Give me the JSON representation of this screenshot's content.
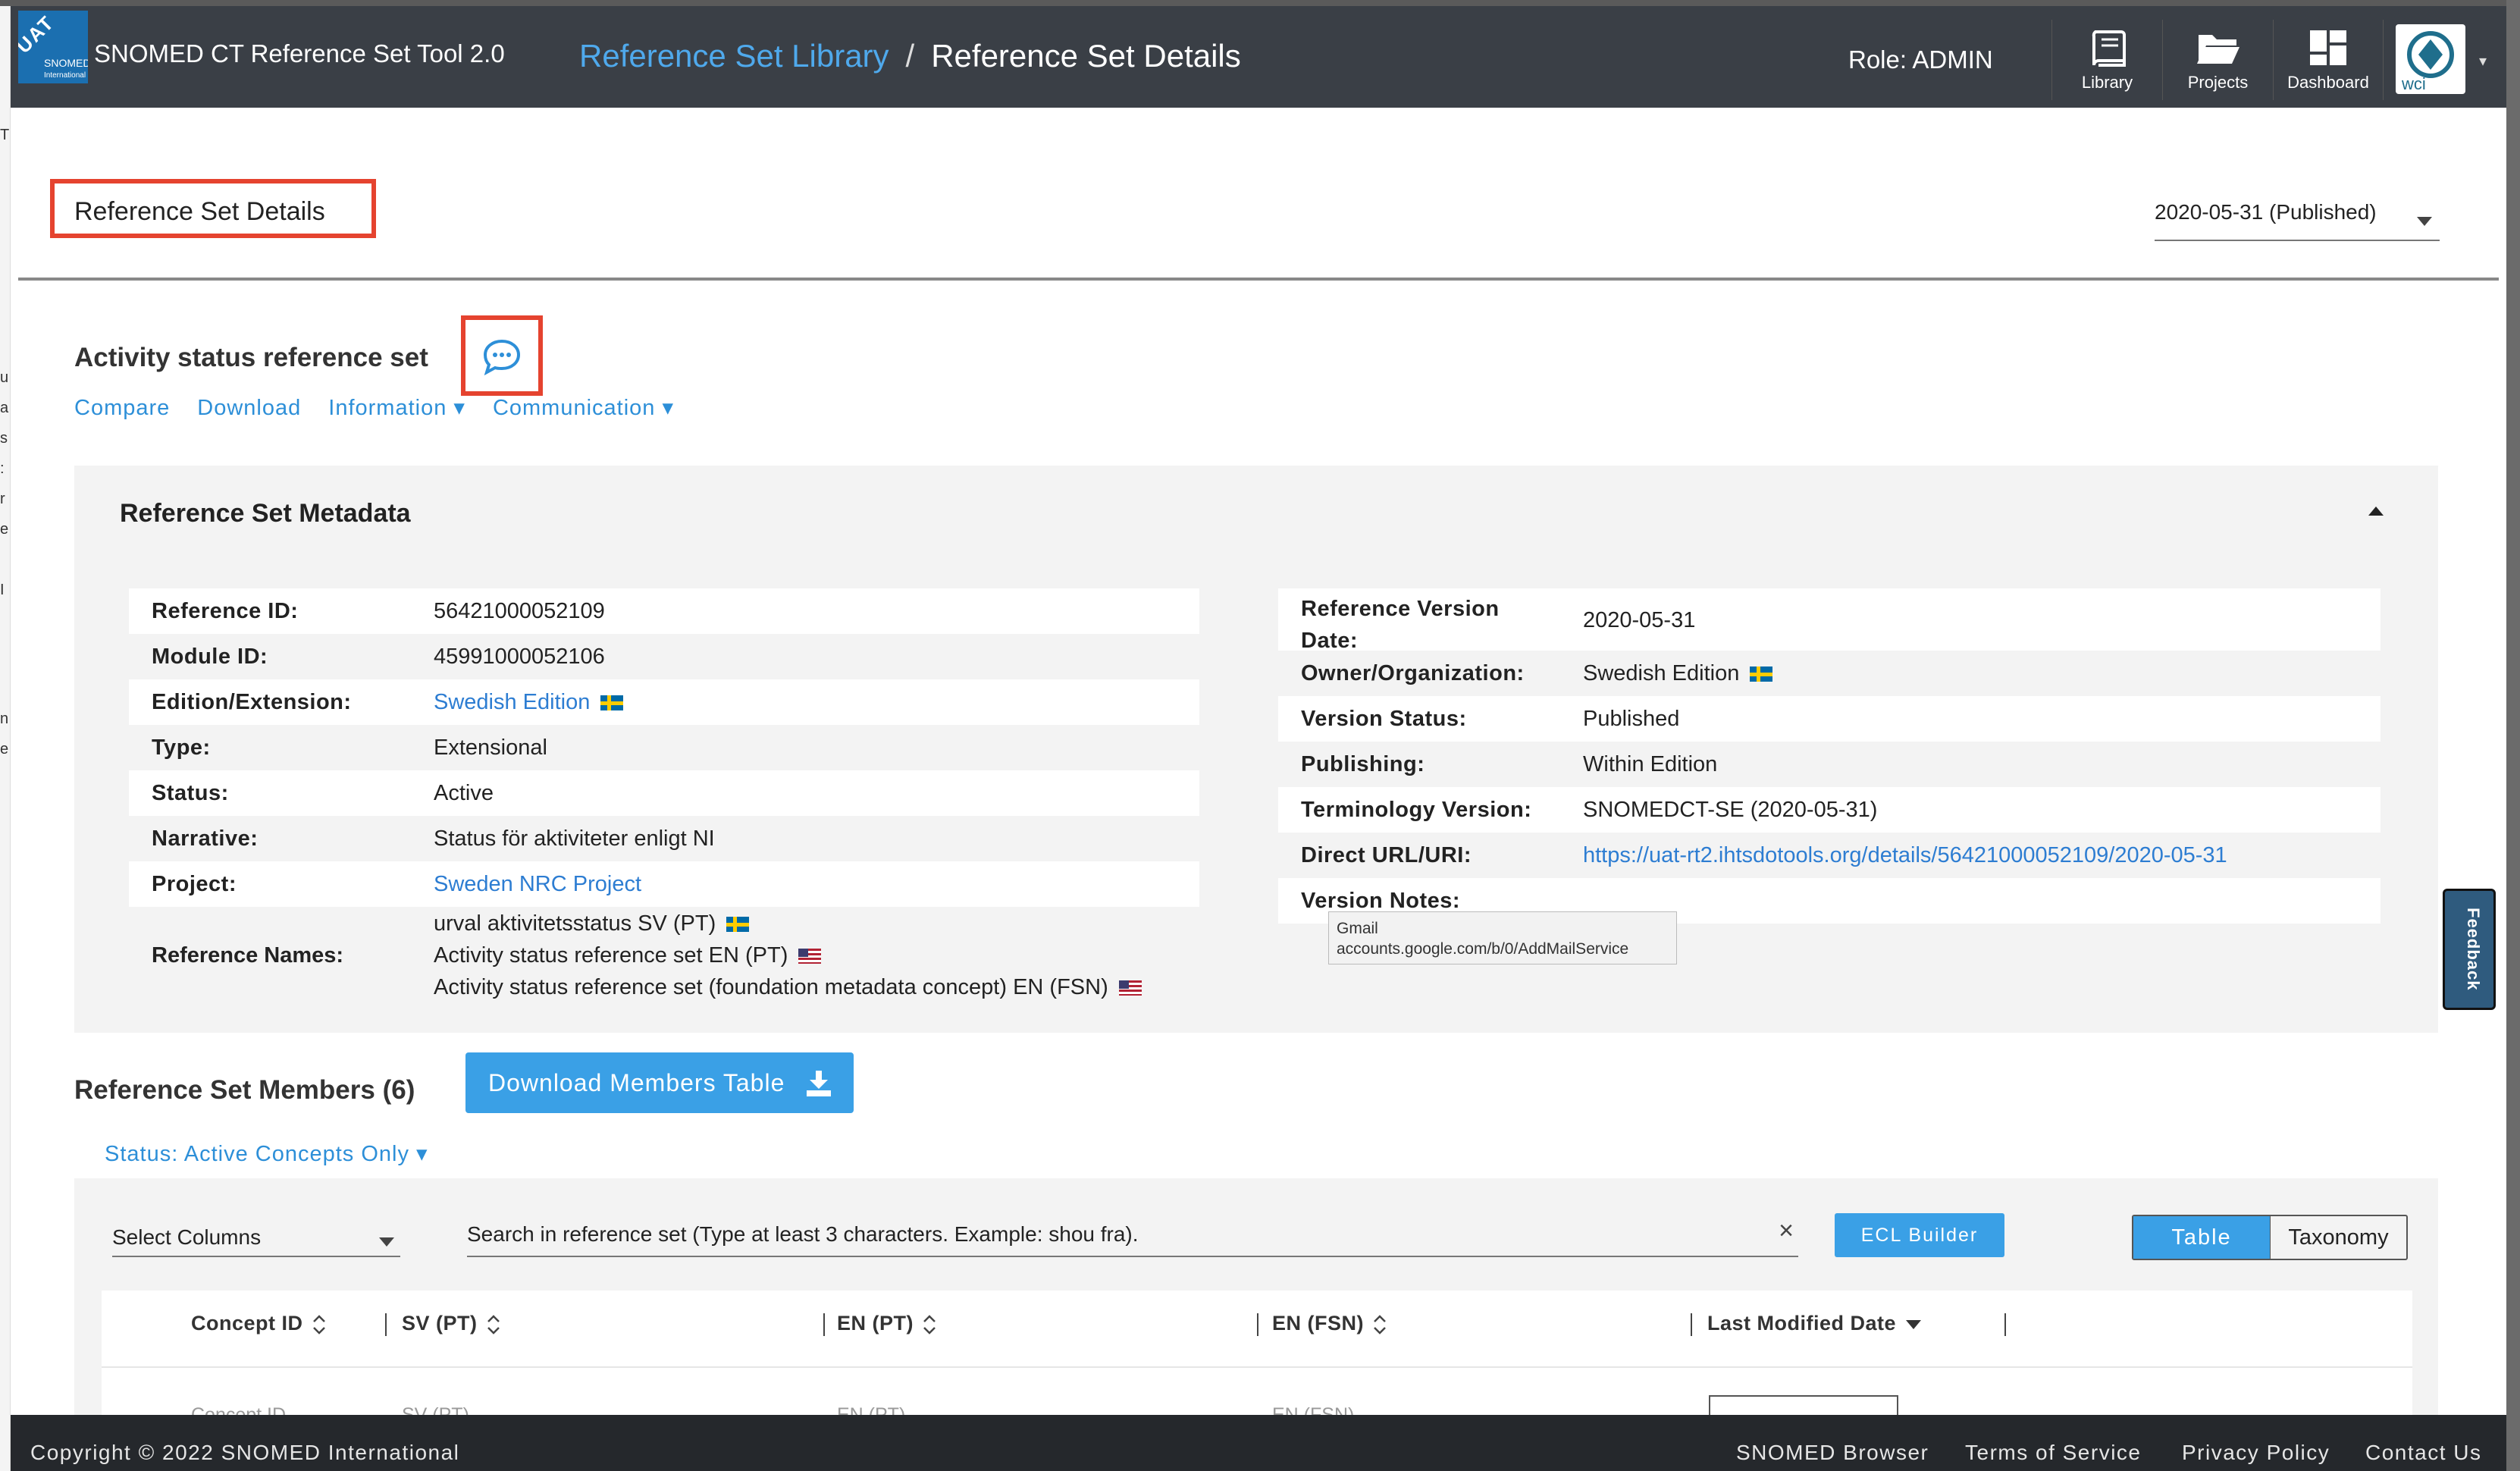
{
  "header": {
    "badge": "UAT",
    "logo_text": "SNOMED",
    "logo_sub": "International",
    "app_name": "SNOMED CT Reference Set Tool 2.0",
    "breadcrumb_link": "Reference Set Library",
    "breadcrumb_sep": "/",
    "breadcrumb_current": "Reference Set Details",
    "role": "Role: ADMIN",
    "nav": [
      {
        "label": "Library",
        "icon": "book-icon"
      },
      {
        "label": "Projects",
        "icon": "folder-open-icon"
      },
      {
        "label": "Dashboard",
        "icon": "dashboard-icon"
      }
    ],
    "avatar_text": "wci"
  },
  "page": {
    "title": "Reference Set Details",
    "version_select": "2020-05-31 (Published)",
    "refset_name": "Activity status reference set",
    "actions": [
      "Compare",
      "Download",
      "Information ▾",
      "Communication ▾"
    ]
  },
  "metadata": {
    "heading": "Reference Set Metadata",
    "left": [
      {
        "key": "Reference ID:",
        "value": "56421000052109"
      },
      {
        "key": "Module ID:",
        "value": "45991000052106"
      },
      {
        "key": "Edition/Extension:",
        "value": "Swedish Edition"
      },
      {
        "key": "Type:",
        "value": "Extensional"
      },
      {
        "key": "Status:",
        "value": "Active"
      },
      {
        "key": "Narrative:",
        "value": "Status för aktiviteter enligt NI"
      },
      {
        "key": "Project:",
        "value": "Sweden NRC Project"
      }
    ],
    "names_key": "Reference Names:",
    "names": [
      "urval aktivitetsstatus SV (PT)",
      "Activity status reference set EN (PT)",
      "Activity status reference set (foundation metadata concept) EN (FSN)"
    ],
    "right": [
      {
        "key": "Reference Version",
        "key2": "Date:",
        "value": "2020-05-31"
      },
      {
        "key": "Owner/Organization:",
        "value": "Swedish Edition"
      },
      {
        "key": "Version Status:",
        "value": "Published"
      },
      {
        "key": "Publishing:",
        "value": "Within Edition"
      },
      {
        "key": "Terminology Version:",
        "value": "SNOMEDCT-SE (2020-05-31)"
      },
      {
        "key": "Direct URL/URI:",
        "value": "https://uat-rt2.ihtsdotools.org/details/56421000052109/2020-05-31"
      },
      {
        "key": "Version Notes:",
        "value": ""
      }
    ]
  },
  "tooltip": {
    "line1": "Gmail",
    "line2": "accounts.google.com/b/0/AddMailService"
  },
  "feedback_label": "Feedback",
  "members": {
    "title": "Reference Set Members (6)",
    "download_label": "Download Members Table",
    "status_filter": "Status: Active Concepts Only ▾",
    "select_columns": "Select Columns",
    "search_placeholder": "Search in reference set (Type at least 3 characters. Example: shou fra).",
    "ecl_label": "ECL Builder",
    "view_table": "Table",
    "view_taxonomy": "Taxonomy",
    "columns": [
      "Concept ID",
      "SV (PT)",
      "EN (PT)",
      "EN (FSN)",
      "Last Modified Date"
    ],
    "filter_hints": [
      "Concept ID",
      "SV (PT)",
      "EN (PT)",
      "EN (FSN)"
    ]
  },
  "footer": {
    "copyright": "Copyright © 2022 SNOMED International",
    "links": [
      "SNOMED Browser",
      "Terms of Service",
      "Privacy Policy",
      "Contact Us"
    ]
  },
  "colors": {
    "header_bg": "#3a3f46",
    "accent": "#3aa0e6",
    "highlight_border": "#e5432f",
    "link": "#2d7dd2"
  }
}
